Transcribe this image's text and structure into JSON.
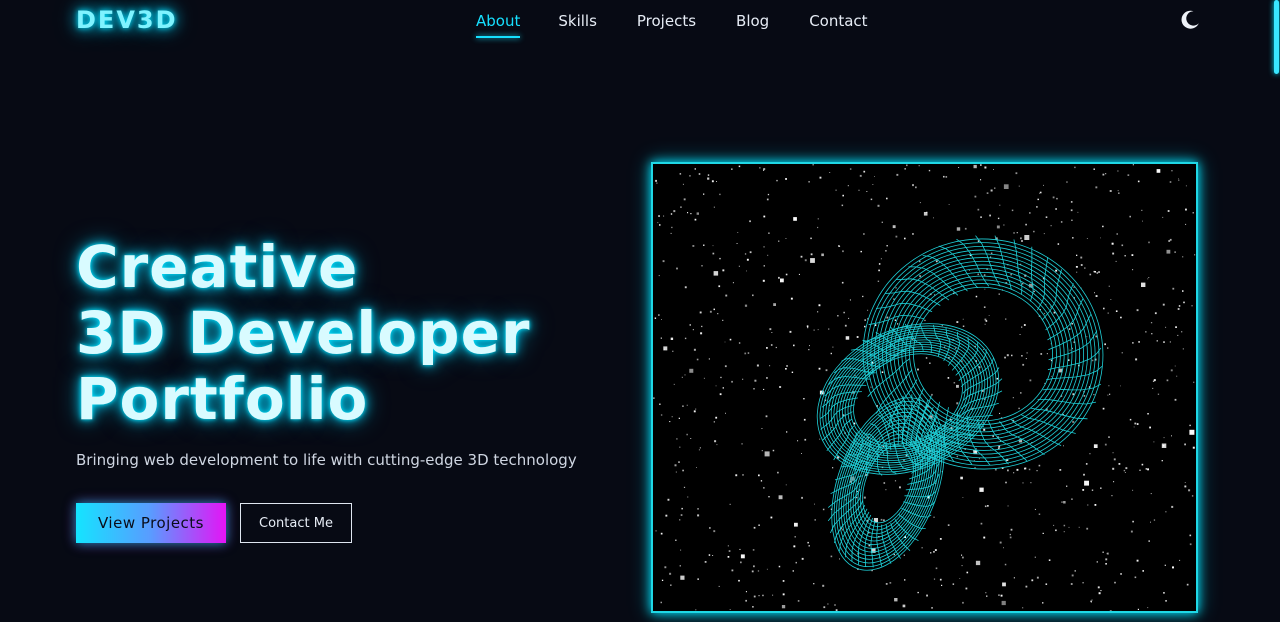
{
  "header": {
    "logo": "DEV3D",
    "nav": [
      {
        "label": "About",
        "active": true
      },
      {
        "label": "Skills",
        "active": false
      },
      {
        "label": "Projects",
        "active": false
      },
      {
        "label": "Blog",
        "active": false
      },
      {
        "label": "Contact",
        "active": false
      }
    ],
    "theme_icon": "moon-icon"
  },
  "hero": {
    "title_lines": [
      "Creative",
      "3D Developer",
      "Portfolio"
    ],
    "subtitle": "Bringing web development to life with cutting-edge 3D technology",
    "primary_button": "View Projects",
    "secondary_button": "Contact Me"
  },
  "scene": {
    "object": "wireframe-torus-knot",
    "background": "starfield",
    "accent": "#1fd8e6"
  },
  "colors": {
    "background": "#070a14",
    "accent_cyan": "#16e0ff",
    "accent_magenta": "#e414f5"
  }
}
